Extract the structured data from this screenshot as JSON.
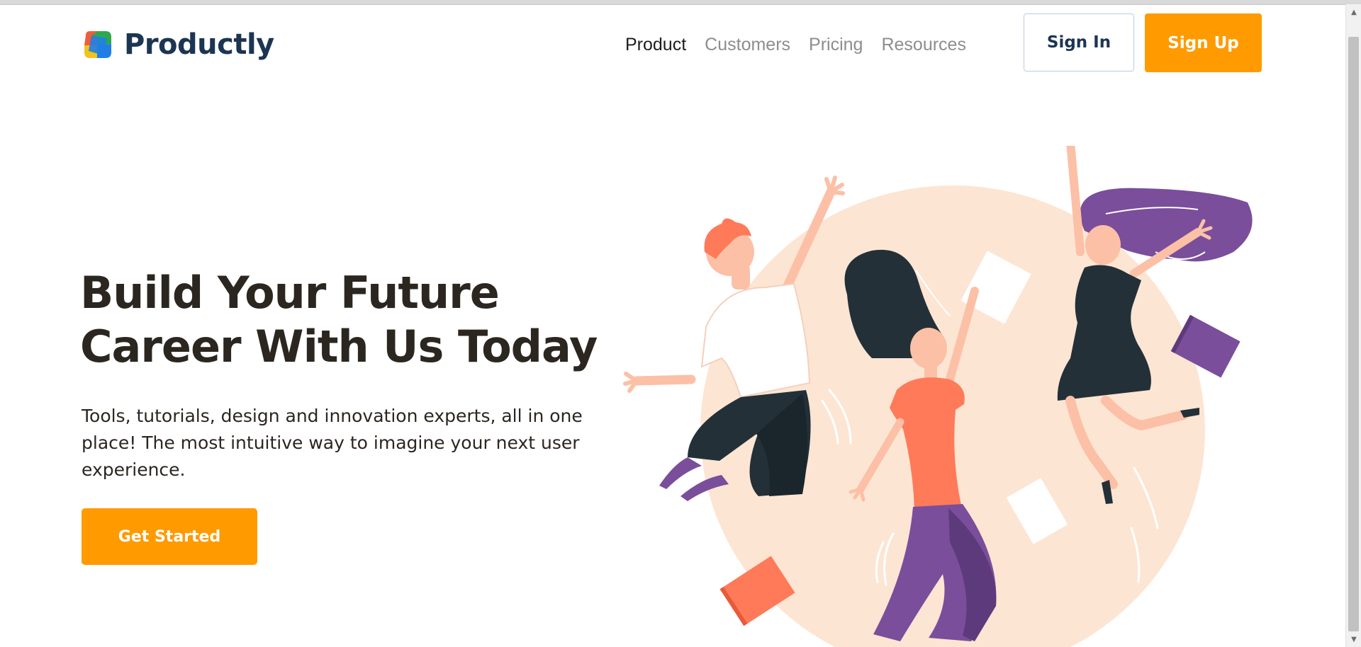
{
  "brand": {
    "name": "Productly"
  },
  "nav": {
    "items": [
      {
        "label": "Product"
      },
      {
        "label": "Customers"
      },
      {
        "label": "Pricing"
      },
      {
        "label": "Resources"
      }
    ]
  },
  "auth": {
    "sign_in": "Sign In",
    "sign_up": "Sign Up"
  },
  "hero": {
    "title_line1": "Build Your Future",
    "title_line2": "Career With Us Today",
    "subtitle": "Tools, tutorials, design and innovation experts, all in one place! The most intuitive way to imagine your next user experience.",
    "cta": "Get Started"
  },
  "colors": {
    "accent": "#ff9a00",
    "brand_navy": "#1c3552",
    "heading": "#2b2620",
    "illustration_bg": "#fde5d3",
    "purple": "#7a4e9b",
    "coral": "#ff7a59",
    "dark": "#233038"
  },
  "icons": {
    "logo": "multicolor-cube-logo",
    "scroll_up": "scroll-up-arrow",
    "scroll_down": "scroll-down-arrow"
  }
}
